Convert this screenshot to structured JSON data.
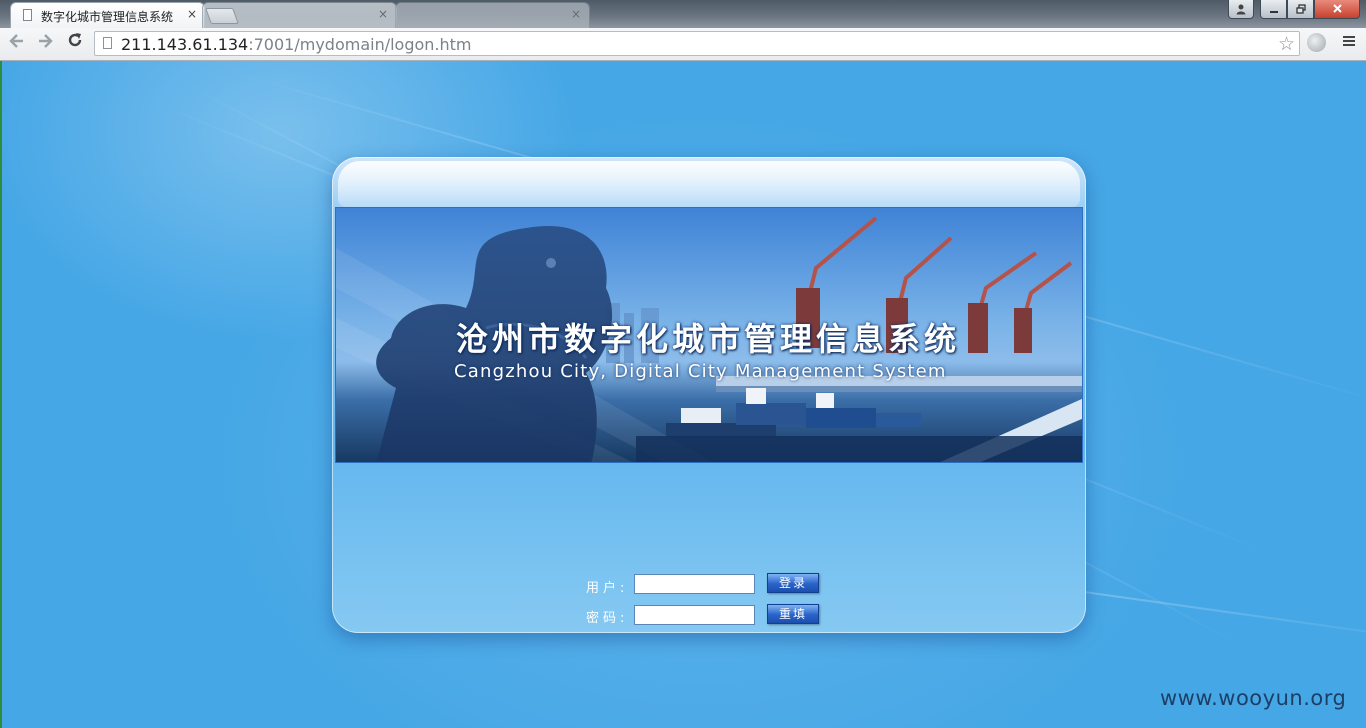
{
  "browser": {
    "active_tab_title": "数字化城市管理信息系统",
    "url_host": "211.143.61.134",
    "url_rest": ":7001/mydomain/logon.htm",
    "tab_close_glyph": "×",
    "icons": {
      "back": "back-arrow-icon",
      "forward": "forward-arrow-icon",
      "reload": "reload-icon",
      "star": "bookmark-star-icon",
      "menu": "menu-icon"
    }
  },
  "banner": {
    "title_cn": "沧州市数字化城市管理信息系统",
    "title_en": "Cangzhou City, Digital City Management System"
  },
  "login_form": {
    "username_label": "用户:",
    "password_label": "密码:",
    "username_value": "",
    "password_value": "",
    "login_button": "登录",
    "reset_button": "重填"
  },
  "watermark": "www.wooyun.org",
  "colors": {
    "page_background": "#46a7e6",
    "button_blue": "#2a63c9",
    "close_button_red": "#c7412d"
  }
}
